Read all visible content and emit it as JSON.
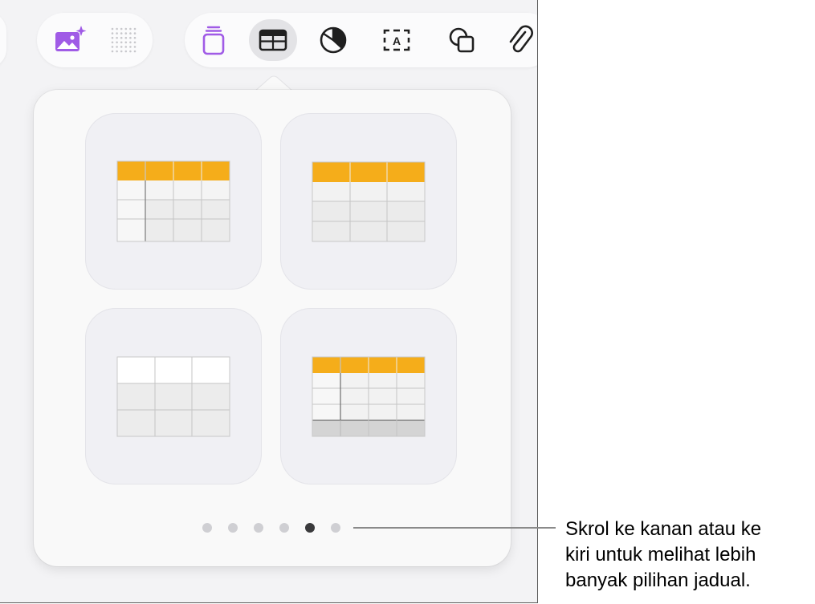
{
  "toolbar": {
    "media_group": {
      "items": [
        {
          "name": "image-playground",
          "icon": "photo-sparkle-icon",
          "color": "#a05be6"
        },
        {
          "name": "media-grid",
          "icon": "dot-grid-icon",
          "color": "#c8c8cc"
        }
      ]
    },
    "insert_group": {
      "items": [
        {
          "name": "text-style",
          "icon": "stacked-card-icon",
          "color": "#a05be6"
        },
        {
          "name": "table",
          "icon": "table-icon",
          "active": true
        },
        {
          "name": "chart",
          "icon": "pie-chart-icon"
        },
        {
          "name": "text-box",
          "icon": "text-box-icon",
          "glyph": "A"
        },
        {
          "name": "shape",
          "icon": "shapes-icon"
        },
        {
          "name": "media",
          "icon": "paperclip-icon"
        }
      ]
    }
  },
  "table_popover": {
    "styles": [
      {
        "name": "header-row-and-column",
        "header_color": "#f5ad1a"
      },
      {
        "name": "header-row",
        "header_color": "#f5ad1a"
      },
      {
        "name": "plain",
        "header_color": "#ffffff"
      },
      {
        "name": "header-row-column-footer",
        "header_color": "#f5ad1a"
      }
    ],
    "page_indicator": {
      "count": 6,
      "active_index": 4
    }
  },
  "callout": {
    "text": "Skrol ke kanan atau ke\nkiri untuk melihat lebih\nbanyak pilihan jadual."
  },
  "colors": {
    "accent": "#a05be6",
    "table_header": "#f5ad1a",
    "active_dot": "#3a3a3c",
    "inactive_dot": "#cfcfd3"
  }
}
